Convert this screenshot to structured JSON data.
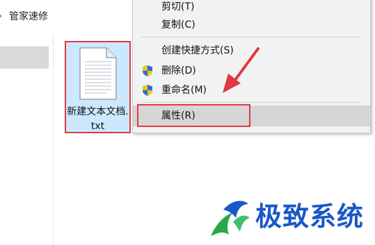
{
  "breadcrumb": {
    "path": "管家速修"
  },
  "file": {
    "name": "新建文本文档.txt",
    "icon": "text-document-icon"
  },
  "context_menu": {
    "items": [
      {
        "label": "剪切(T)",
        "icon": null
      },
      {
        "label": "复制(C)",
        "icon": null
      },
      {
        "label": "创建快捷方式(S)",
        "icon": null
      },
      {
        "label": "删除(D)",
        "icon": "uac-shield-icon"
      },
      {
        "label": "重命名(M)",
        "icon": "uac-shield-icon"
      },
      {
        "label": "属性(R)",
        "icon": null,
        "highlighted": true
      }
    ]
  },
  "watermark": {
    "text": "极致系统",
    "logo": "dragon-logo-icon"
  },
  "colors": {
    "annotation_red": "#e0383e",
    "selection_blue": "#cce8ff",
    "watermark_blue": "#1a58c8"
  }
}
